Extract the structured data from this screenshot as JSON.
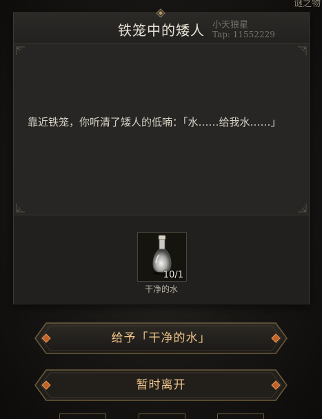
{
  "background": {
    "top_right_label": "谜之物"
  },
  "dialog": {
    "title": "铁笼中的矮人",
    "watermark": {
      "name": "小天狼星",
      "tap_id": "Tap: 11552229"
    },
    "story_text": "靠近铁笼，你听清了矮人的低喃：「水……给我水……」",
    "reward_item": {
      "icon": "water-bottle-icon",
      "count_text": "10/1",
      "name": "干净的水"
    }
  },
  "actions": {
    "give_label": "给予「干净的水」",
    "leave_label": "暂时离开"
  },
  "colors": {
    "accent_gold": "#f0c48a",
    "panel_bg": "#262523",
    "text_light": "#d6d1c6"
  }
}
